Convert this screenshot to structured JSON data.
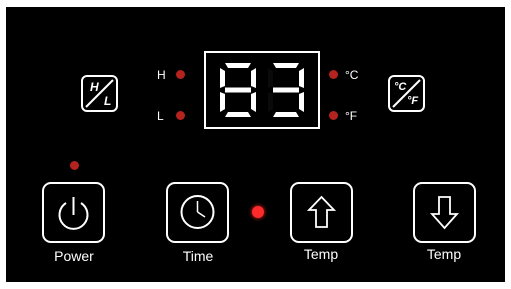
{
  "display": {
    "digits": [
      "8",
      "3"
    ],
    "led_color": "#b5231f",
    "active_led_color": "#ff2a2a"
  },
  "fan_speed": {
    "button_top": "H",
    "button_bottom": "L",
    "high_label": "H",
    "low_label": "L"
  },
  "units": {
    "button_top": "°C",
    "button_bottom": "°F",
    "celsius_label": "°C",
    "fahrenheit_label": "°F"
  },
  "buttons": {
    "power": "Power",
    "time": "Time",
    "temp_up": "Temp",
    "temp_down": "Temp"
  },
  "icons": {
    "power": "power-icon",
    "time": "clock-icon",
    "temp_up": "arrow-up-icon",
    "temp_down": "arrow-down-icon"
  }
}
